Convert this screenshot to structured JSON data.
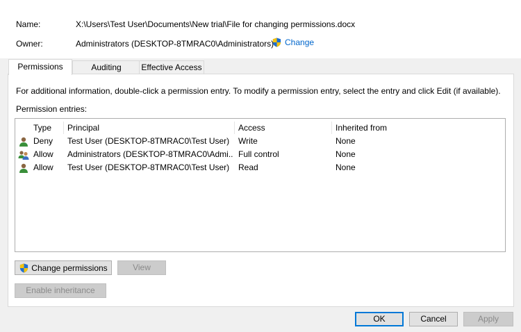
{
  "header": {
    "name_label": "Name:",
    "name_value": "X:\\Users\\Test User\\Documents\\New trial\\File for changing permissions.docx",
    "owner_label": "Owner:",
    "owner_value": "Administrators (DESKTOP-8TMRAC0\\Administrators)",
    "change_link": "Change"
  },
  "tabs": [
    {
      "label": "Permissions",
      "active": true
    },
    {
      "label": "Auditing",
      "active": false
    },
    {
      "label": "Effective Access",
      "active": false
    }
  ],
  "panel": {
    "info_text": "For additional information, double-click a permission entry. To modify a permission entry, select the entry and click Edit (if available).",
    "entries_label": "Permission entries:",
    "columns": [
      "Type",
      "Principal",
      "Access",
      "Inherited from"
    ],
    "rows": [
      {
        "icon": "single-user-icon",
        "type": "Deny",
        "principal": "Test User (DESKTOP-8TMRAC0\\Test User)",
        "access": "Write",
        "inherited": "None"
      },
      {
        "icon": "group-users-icon",
        "type": "Allow",
        "principal": "Administrators (DESKTOP-8TMRAC0\\Admi...",
        "access": "Full control",
        "inherited": "None"
      },
      {
        "icon": "single-user-icon",
        "type": "Allow",
        "principal": "Test User (DESKTOP-8TMRAC0\\Test User)",
        "access": "Read",
        "inherited": "None"
      }
    ],
    "change_permissions_button": "Change permissions",
    "view_button": "View",
    "enable_inheritance_button": "Enable inheritance"
  },
  "footer": {
    "ok": "OK",
    "cancel": "Cancel",
    "apply": "Apply"
  },
  "colors": {
    "link": "#0066cc",
    "default_button_border": "#0078d7"
  }
}
